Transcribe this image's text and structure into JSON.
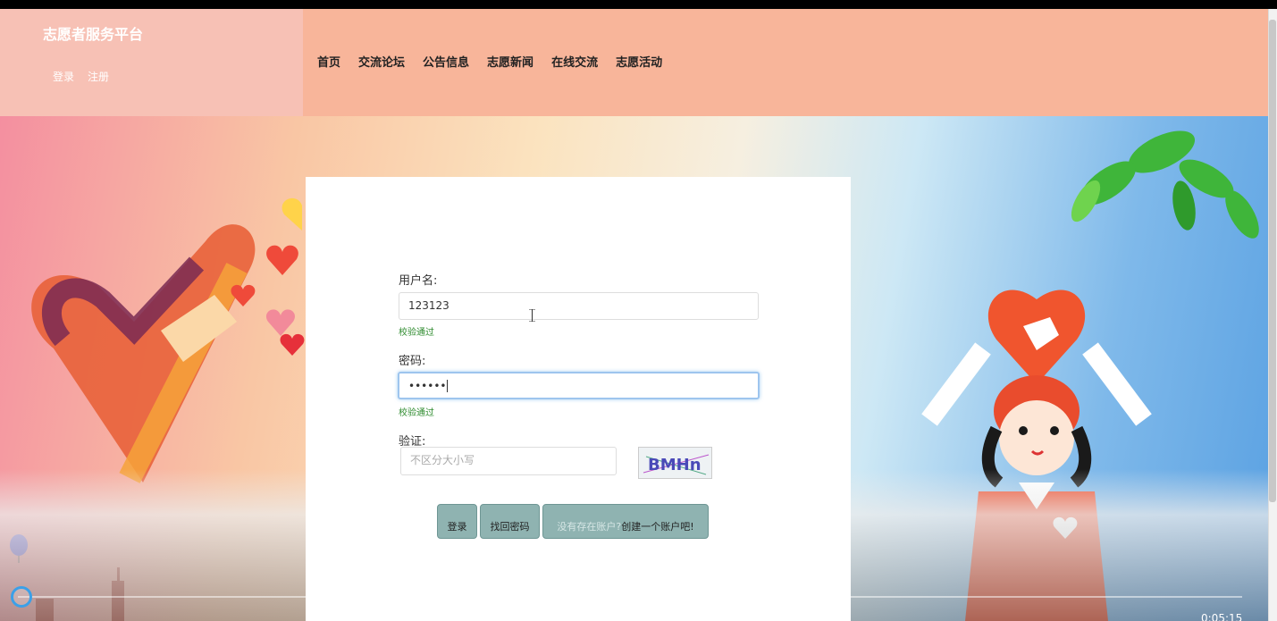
{
  "header": {
    "brand": "志愿者服务平台",
    "auth": [
      "登录",
      "注册"
    ],
    "nav": [
      "首页",
      "交流论坛",
      "公告信息",
      "志愿新闻",
      "在线交流",
      "志愿活动"
    ]
  },
  "login_form": {
    "username": {
      "label": "用户名:",
      "value": "123123",
      "validation": "校验通过"
    },
    "password": {
      "label": "密码:",
      "value": "••••••",
      "validation": "校验通过"
    },
    "captcha": {
      "label": "验证:",
      "placeholder": "不区分大小写",
      "code": "BMHn"
    },
    "buttons": {
      "login": "登录",
      "forgot": "找回密码",
      "no_account": "没有存在账户?",
      "create_account": "创建一个账户吧!"
    }
  },
  "video": {
    "timecode": "0:05:15",
    "progress": 0.01
  }
}
